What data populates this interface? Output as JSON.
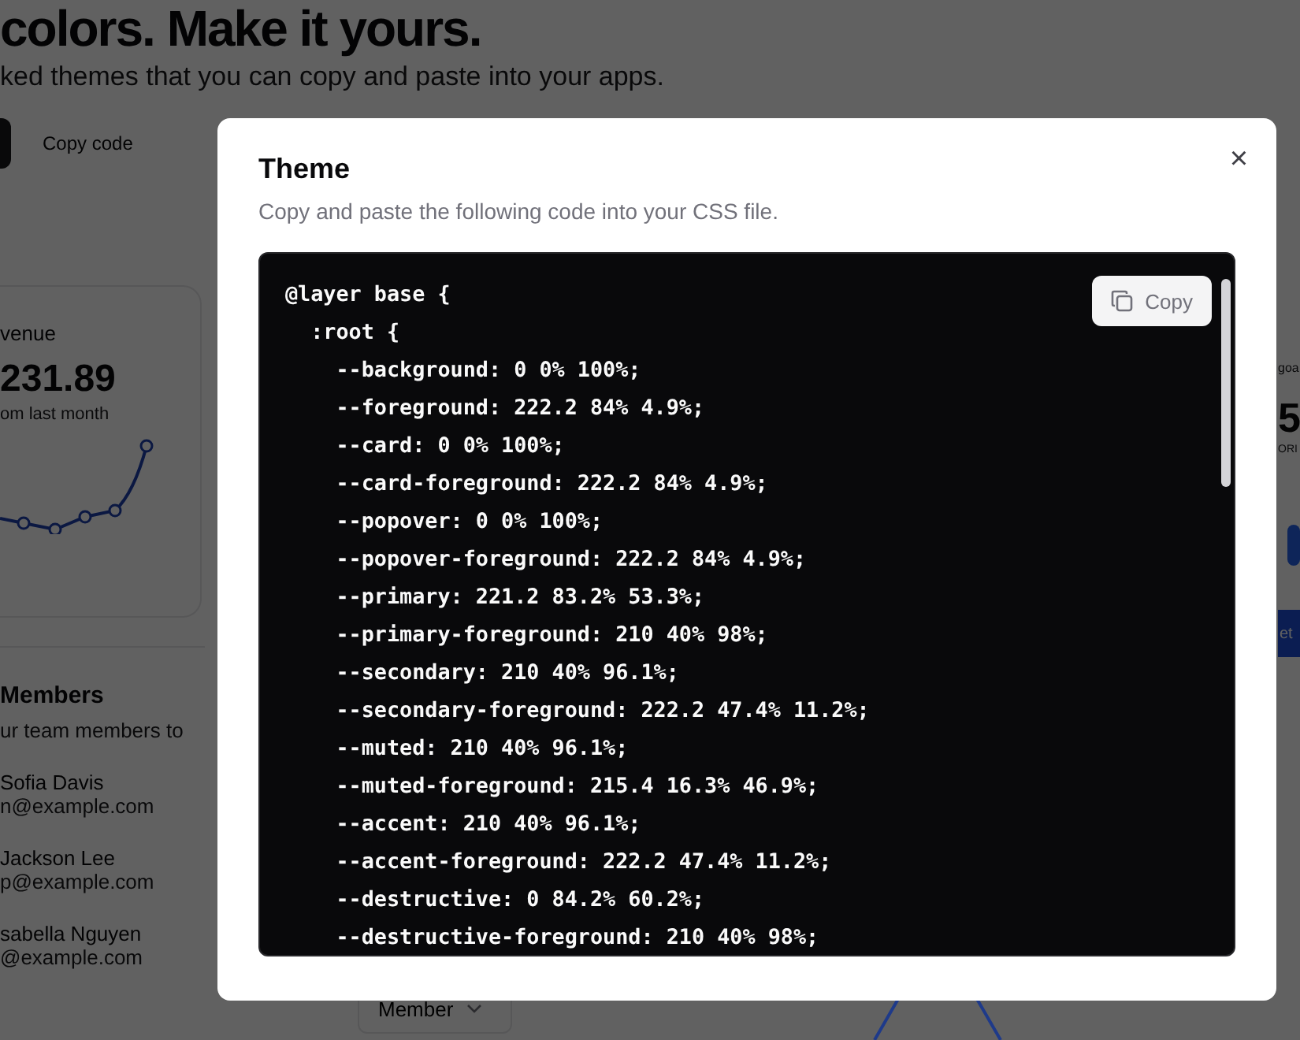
{
  "page": {
    "heading": "colors. Make it yours.",
    "subheading": "ked themes that you can copy and paste into your apps.",
    "copy_code": "Copy code"
  },
  "revenue_card": {
    "title": "venue",
    "amount": "231.89",
    "note": "om last month"
  },
  "members_card": {
    "title": "Members",
    "description": "ur team members to",
    "members": [
      {
        "name": "Sofia Davis",
        "email": "n@example.com"
      },
      {
        "name": "Jackson Lee",
        "email": "p@example.com"
      },
      {
        "name": "sabella Nguyen",
        "email": "@example.com",
        "role": "Member"
      }
    ]
  },
  "goal_card": {
    "label": "goa",
    "value": "5",
    "unit": "ORI",
    "button": "et"
  },
  "dialog": {
    "title": "Theme",
    "description": "Copy and paste the following code into your CSS file.",
    "copy_button": "Copy",
    "close": "×",
    "code_lines": [
      "@layer base {",
      "  :root {",
      "    --background: 0 0% 100%;",
      "    --foreground: 222.2 84% 4.9%;",
      "    --card: 0 0% 100%;",
      "    --card-foreground: 222.2 84% 4.9%;",
      "    --popover: 0 0% 100%;",
      "    --popover-foreground: 222.2 84% 4.9%;",
      "    --primary: 221.2 83.2% 53.3%;",
      "    --primary-foreground: 210 40% 98%;",
      "    --secondary: 210 40% 96.1%;",
      "    --secondary-foreground: 222.2 47.4% 11.2%;",
      "    --muted: 210 40% 96.1%;",
      "    --muted-foreground: 215.4 16.3% 46.9%;",
      "    --accent: 210 40% 96.1%;",
      "    --accent-foreground: 222.2 47.4% 11.2%;",
      "    --destructive: 0 84.2% 60.2%;",
      "    --destructive-foreground: 210 40% 98%;"
    ]
  }
}
